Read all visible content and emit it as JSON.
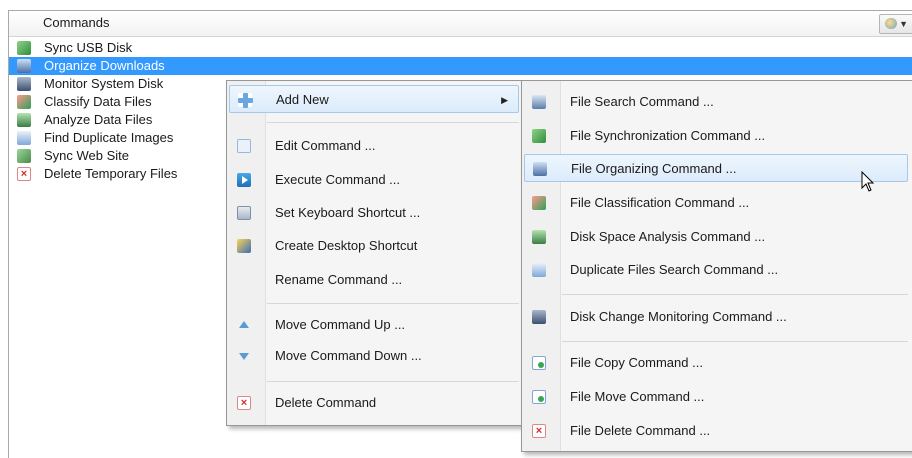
{
  "header": {
    "title": "Commands",
    "view_icon": "view-options-icon"
  },
  "commands": [
    {
      "label": "Sync USB Disk",
      "icon": "sync-icon"
    },
    {
      "label": "Organize Downloads",
      "icon": "organize-icon",
      "selected": true
    },
    {
      "label": "Monitor System Disk",
      "icon": "monitor-icon"
    },
    {
      "label": "Classify Data Files",
      "icon": "classify-icon"
    },
    {
      "label": "Analyze Data Files",
      "icon": "analyze-icon"
    },
    {
      "label": "Find Duplicate Images",
      "icon": "duplicates-icon"
    },
    {
      "label": "Sync Web Site",
      "icon": "sync-icon"
    },
    {
      "label": "Delete Temporary Files",
      "icon": "delete-icon"
    }
  ],
  "context_menu": {
    "add_new": "Add New",
    "edit": "Edit Command ...",
    "execute": "Execute Command ...",
    "shortcut": "Set Keyboard Shortcut ...",
    "desktop": "Create Desktop Shortcut",
    "rename": "Rename Command ...",
    "move_up": "Move Command Up ...",
    "move_down": "Move Command Down ...",
    "delete": "Delete Command"
  },
  "submenu": {
    "search": "File Search Command ...",
    "sync": "File Synchronization Command ...",
    "organize": "File Organizing Command ...",
    "classify": "File Classification Command ...",
    "analysis": "Disk Space Analysis Command ...",
    "duplicates": "Duplicate Files Search Command ...",
    "monitoring": "Disk Change Monitoring Command ...",
    "copy": "File Copy Command ...",
    "move": "File Move Command ...",
    "delete": "File Delete Command ..."
  },
  "colors": {
    "selection": "#3399ff",
    "menu_highlight": "#dcebfb"
  }
}
